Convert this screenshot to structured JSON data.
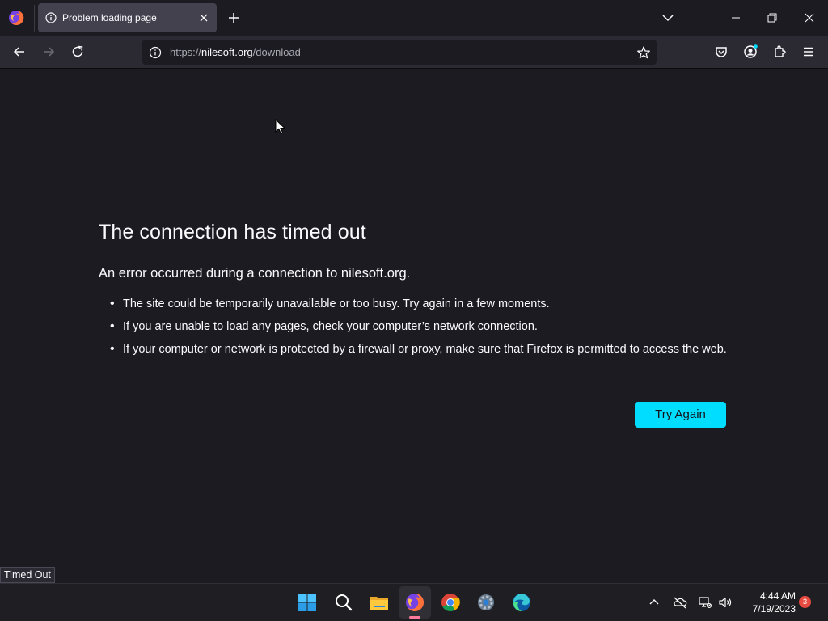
{
  "tab": {
    "title": "Problem loading page"
  },
  "urlbar": {
    "prefix": "https://",
    "host": "nilesoft.org",
    "path": "/download"
  },
  "error": {
    "title": "The connection has timed out",
    "subtitle": "An error occurred during a connection to nilesoft.org.",
    "bullets": [
      "The site could be temporarily unavailable or too busy. Try again in a few moments.",
      "If you are unable to load any pages, check your computer’s network connection.",
      "If your computer or network is protected by a firewall or proxy, make sure that Firefox is permitted to access the web."
    ],
    "button": "Try Again"
  },
  "status": {
    "text": "Timed Out"
  },
  "taskbar": {
    "apps": [
      "start-icon",
      "search-icon",
      "file-explorer-icon",
      "firefox-icon",
      "chrome-icon",
      "settings-icon",
      "edge-icon"
    ],
    "active_app": "firefox",
    "time": "4:44 AM",
    "date": "7/19/2023",
    "notifications": "3"
  },
  "colors": {
    "accent": "#00ddff",
    "background": "#1c1b22",
    "toolbar": "#2b2a33",
    "tab_active": "#42414d"
  }
}
